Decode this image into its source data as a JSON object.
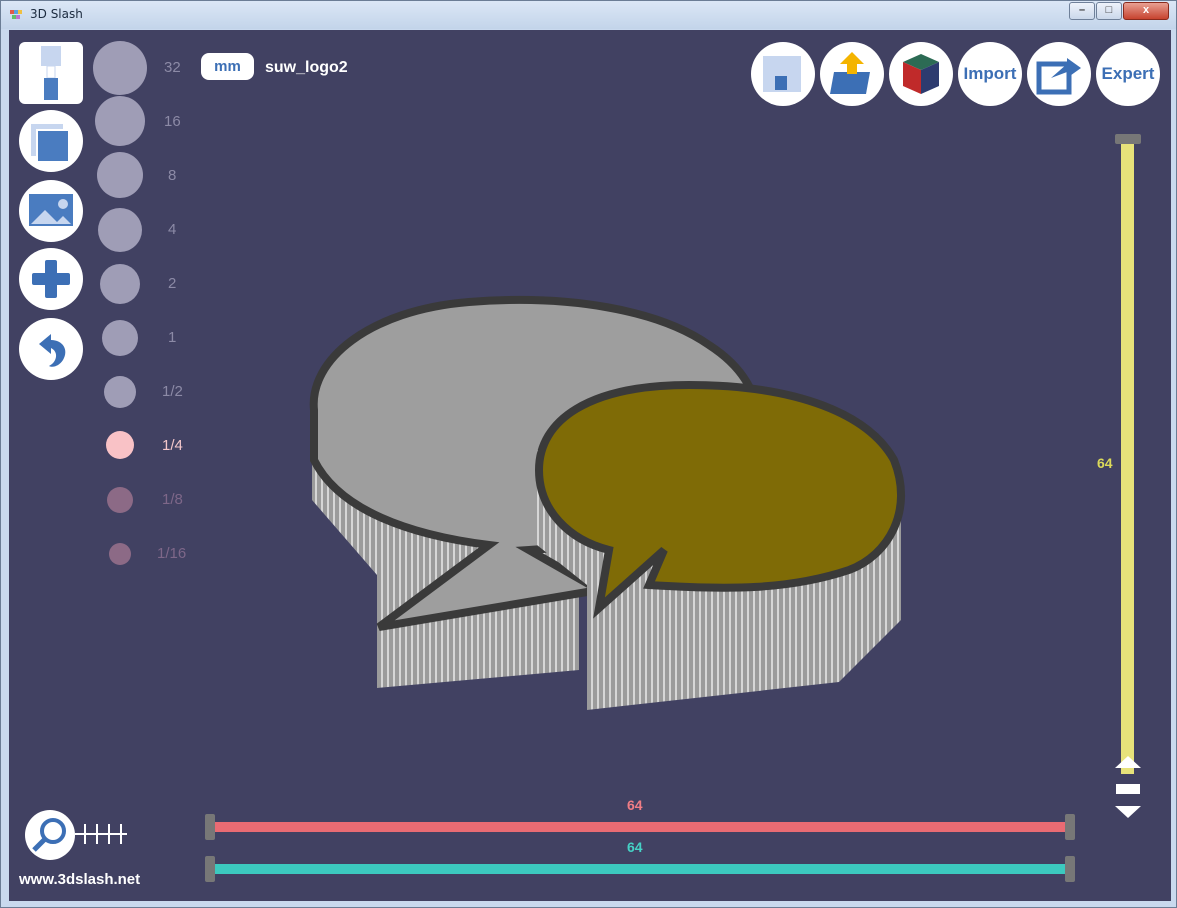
{
  "window": {
    "title": "3D Slash",
    "buttons": {
      "min": "",
      "max": "",
      "close": "x"
    }
  },
  "tool_sizes": [
    "32",
    "16",
    "8",
    "4",
    "2",
    "1",
    "1/2",
    "1/4",
    "1/8",
    "1/16"
  ],
  "selected_size": "1/4",
  "unit": "mm",
  "filename": "suw_logo2",
  "toolbar": {
    "import_label": "Import",
    "expert_label": "Expert"
  },
  "sliders": {
    "vertical_value": "64",
    "red_value": "64",
    "teal_value": "64"
  },
  "website": "www.3dslash.net",
  "colors": {
    "background": "#414162",
    "gold": "#7f6b06",
    "gray_face": "#9e9e9e",
    "red_slider": "#e96b73",
    "teal_slider": "#3cc9bf",
    "yellow_slider": "#e1e26a"
  }
}
